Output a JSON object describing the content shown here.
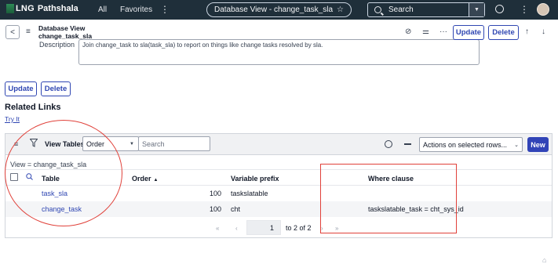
{
  "topnav": {
    "logo_prefix": "LNG",
    "logo_name": "Pathshala",
    "links": [
      "All",
      "Favorites"
    ],
    "more_glyph": "⋮",
    "record_title": "Database View - change_task_sla",
    "star_glyph": "☆",
    "search_placeholder": "Search",
    "caret_glyph": "▼",
    "kebab_glyph": "⋮",
    "icons": [
      "search-icon",
      "globe-icon",
      "more-icon",
      "avatar"
    ]
  },
  "formbar": {
    "back_glyph": "<",
    "menu_glyph": "≡",
    "title_line1": "Database View",
    "title_line2": "change_task_sla",
    "attach_glyph": "⊘",
    "settings_glyph": "⚌",
    "more_glyph": "···",
    "update_label": "Update",
    "delete_label": "Delete",
    "up_glyph": "↑",
    "down_glyph": "↓"
  },
  "description": {
    "label": "Description",
    "value": "Join change_task to sla(task_sla) to report on things like change tasks resolved by sla."
  },
  "bottom_buttons": {
    "update_label": "Update",
    "delete_label": "Delete"
  },
  "related_links": {
    "title": "Related Links",
    "try_it": "Try It"
  },
  "list": {
    "menu_glyph": "≡",
    "label": "View Tables",
    "sort_field": "Order",
    "search_placeholder": "Search",
    "actions_placeholder": "Actions on selected rows...",
    "new_label": "New",
    "breadcrumb": "View = change_task_sla",
    "columns": {
      "table": "Table",
      "order": "Order",
      "variable_prefix": "Variable prefix",
      "where_clause": "Where clause"
    },
    "sort_glyph": "▲",
    "rows": [
      {
        "table": "task_sla",
        "order": "100",
        "variable_prefix": "taskslatable",
        "where_clause": ""
      },
      {
        "table": "change_task",
        "order": "100",
        "variable_prefix": "cht",
        "where_clause": "taskslatable_task = cht_sys_id"
      }
    ],
    "pager": {
      "first_glyph": "«",
      "prev_glyph": "‹",
      "next_glyph": "›",
      "last_glyph": "»",
      "current": "1",
      "range_text": "to 2 of 2"
    }
  },
  "colors": {
    "nav_bg": "#1f2f3a",
    "accent": "#2f46b2",
    "annotation": "#e0413a"
  }
}
